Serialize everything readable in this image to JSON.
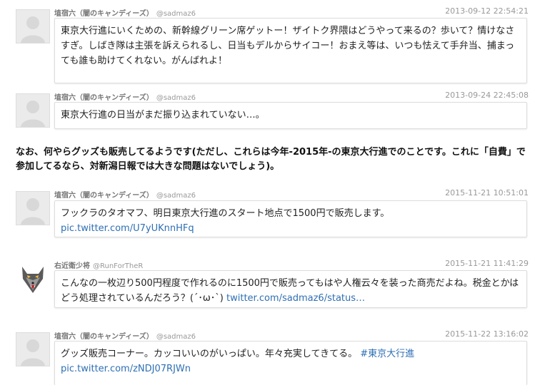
{
  "tweets": [
    {
      "author": "埴宿六（闇のキャンディーズ）",
      "handle": "@sadmaz6",
      "timestamp": "2013-09-12 22:54:21",
      "text": "東京大行進にいくための、新幹線グリーン席ゲットー！ザイトク界隈はどうやって来るの？歩いて？情けなさすぎ。しばき隊は主張を訴えられるし、日当もデルからサイコー！おまえ等は、いつも怯えて手弁当、捕まっても誰も助けてくれない。がんばれよ！"
    },
    {
      "author": "埴宿六（闇のキャンディーズ）",
      "handle": "@sadmaz6",
      "timestamp": "2013-09-24 22:45:08",
      "text": "東京大行進の日当がまだ振り込まれていない…。"
    },
    {
      "author": "埴宿六（闇のキャンディーズ）",
      "handle": "@sadmaz6",
      "timestamp": "2015-11-21 10:51:01",
      "text": "フックラのタオマフ、明日東京大行進のスタート地点で1500円で販売します。",
      "link": "pic.twitter.com/U7yUKnnHFq"
    },
    {
      "author": "右近衛少将",
      "handle": "@RunForTheR",
      "timestamp": "2015-11-21 11:41:29",
      "text": "こんなの一枚辺り500円程度で作れるのに1500円で販売ってもはや人権云々を装った商売だよね。税金とかはどう処理されているんだろう？(´･ω･`)",
      "link": "twitter.com/sadmaz6/status…"
    },
    {
      "author": "埴宿六（闇のキャンディーズ）",
      "handle": "@sadmaz6",
      "timestamp": "2015-11-22 13:16:02",
      "text": "グッズ販売コーナー。カッコいいのがいっぱい。年々充実してきてる。",
      "hashtag": "#東京大行進",
      "link": "pic.twitter.com/zNDJ07RJWn"
    }
  ],
  "note": "なお、何やらグッズも販売してるようです(ただし、これらは今年-2015年-の東京大行進でのことです。これに「自費」で参加してるなら、対新潟日報では大きな問題はないでしょう)。",
  "colors": {
    "link": "#2e6fb4",
    "bubble_border": "#dcdcdc",
    "meta": "#888888"
  },
  "icons": [
    "default-avatar-icon",
    "wolf-avatar-icon"
  ]
}
